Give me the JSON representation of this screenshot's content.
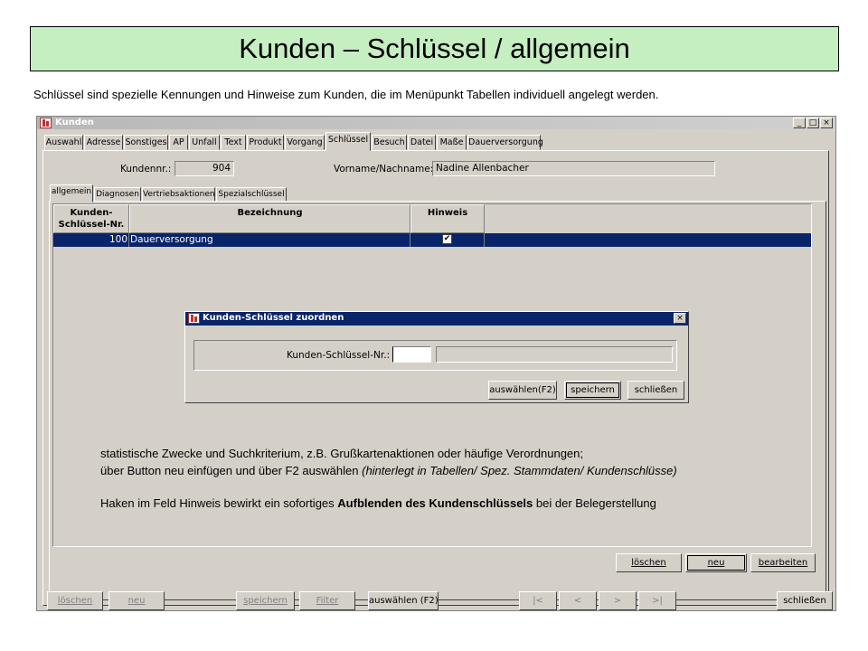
{
  "slide": {
    "title": "Kunden – Schlüssel / allgemein",
    "subtitle": "Schlüssel sind spezielle Kennungen und Hinweise zum Kunden, die im Menüpunkt Tabellen individuell angelegt werden."
  },
  "window": {
    "title": "Kunden",
    "controls": {
      "minimize": "_",
      "maximize": "□",
      "close": "×"
    }
  },
  "tabs": [
    "Auswahl",
    "Adresse",
    "Sonstiges",
    "AP",
    "Unfall",
    "Text",
    "Produkt",
    "Vorgang",
    "Schlüssel",
    "Besuch",
    "Datei",
    "Maße",
    "Dauerversorgung"
  ],
  "active_tab": "Schlüssel",
  "customer": {
    "number_label": "Kundennr.:",
    "number_value": "904",
    "name_label": "Vorname/Nachname:",
    "name_value": "Nadine Allenbacher"
  },
  "subtabs": [
    "allgemein",
    "Diagnosen",
    "Vertriebsaktionen",
    "Spezialschlüssel"
  ],
  "active_subtab": "allgemein",
  "table": {
    "headers": {
      "key_nr_line1": "Kunden-",
      "key_nr_line2": "Schlüssel-Nr.",
      "description": "Bezeichnung",
      "hint": "Hinweis"
    },
    "rows": [
      {
        "key_nr": "100",
        "description": "Dauerversorgung",
        "hint": "✔"
      }
    ]
  },
  "dialog": {
    "title": "Kunden-Schlüssel zuordnen",
    "close": "×",
    "field_label": "Kunden-Schlüssel-Nr.:",
    "field_value": "",
    "buttons": {
      "select": "auswählen(F2)",
      "save": "speichern",
      "close": "schließen"
    }
  },
  "notes": {
    "line1": "statistische Zwecke und Suchkriterium, z.B. Grußkartenaktionen oder häufige Verordnungen;",
    "line2_plain": "über Button neu einfügen und über F2 auswählen ",
    "line2_italic": "(hinterlegt in Tabellen/ Spez. Stammdaten/ Kundenschlüsse)",
    "line3_pre": "Haken im Feld Hinweis bewirkt ein sofortiges ",
    "line3_bold": "Aufblenden des Kundenschlüssels",
    "line3_post": " bei der Belegerstellung"
  },
  "panel_buttons": {
    "delete": "löschen",
    "new": "neu",
    "edit": "bearbeiten"
  },
  "bottom_buttons": {
    "delete": "löschen",
    "new": "neu",
    "save": "speichern",
    "filter": "Filter",
    "select": "auswählen (F2)",
    "first": "|<",
    "prev": "<",
    "next": ">",
    "last": ">|",
    "close": "schließen"
  },
  "colors": {
    "selection": "#0a246a",
    "title_bg": "#c5eec1",
    "window_bg": "#d4d0c8"
  }
}
